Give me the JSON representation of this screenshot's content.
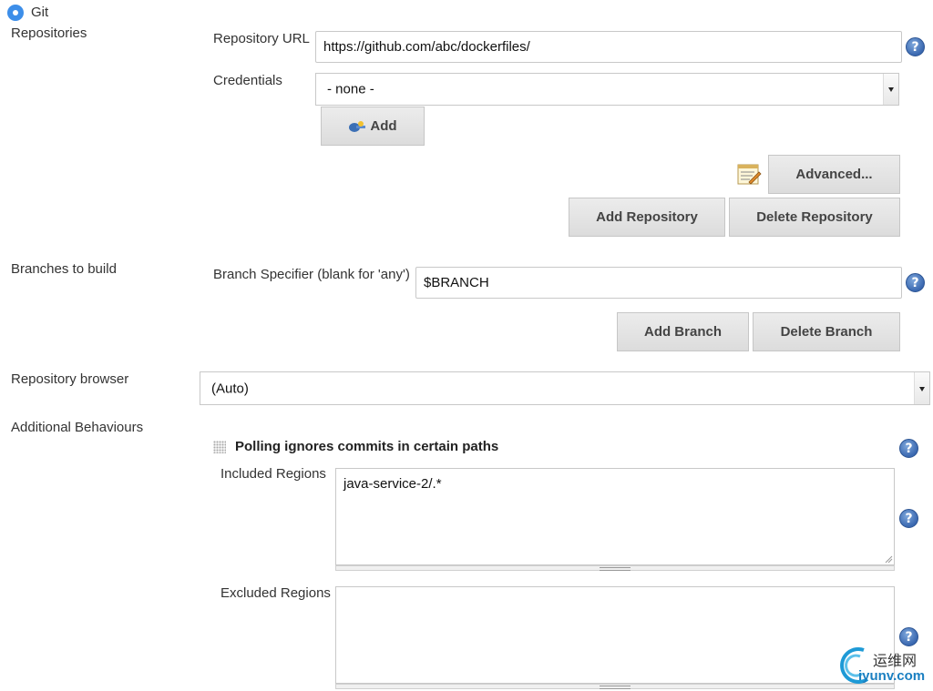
{
  "scm": {
    "option_label": "Git",
    "selected": true
  },
  "repositories": {
    "section_label": "Repositories",
    "url_label": "Repository URL",
    "url_value": "https://github.com/abc/dockerfiles/",
    "credentials_label": "Credentials",
    "credentials_value": "- none -",
    "add_label": "Add",
    "advanced_label": "Advanced...",
    "add_repo_label": "Add Repository",
    "delete_repo_label": "Delete Repository"
  },
  "branches": {
    "section_label": "Branches to build",
    "specifier_label": "Branch Specifier (blank for 'any')",
    "specifier_value": "$BRANCH",
    "add_branch_label": "Add Branch",
    "delete_branch_label": "Delete Branch"
  },
  "browser": {
    "section_label": "Repository browser",
    "value": "(Auto)"
  },
  "behaviours": {
    "section_label": "Additional Behaviours",
    "polling_title": "Polling ignores commits in certain paths",
    "included_label": "Included Regions",
    "included_value": "java-service-2/.*",
    "excluded_label": "Excluded Regions",
    "excluded_value": ""
  },
  "help_glyph": "?",
  "watermark": {
    "text": "运维网",
    "url": "iyunv.com"
  }
}
